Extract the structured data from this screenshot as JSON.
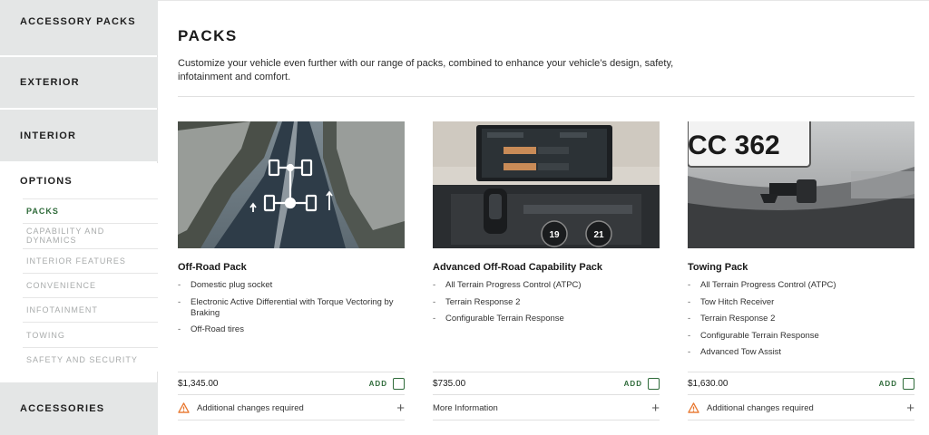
{
  "sidebar": {
    "sections": [
      {
        "label": "ACCESSORY PACKS"
      },
      {
        "label": "EXTERIOR"
      },
      {
        "label": "INTERIOR"
      },
      {
        "label": "OPTIONS"
      },
      {
        "label": "ACCESSORIES"
      }
    ],
    "options_items": [
      {
        "label": "PACKS",
        "active": true
      },
      {
        "label": "CAPABILITY AND DYNAMICS"
      },
      {
        "label": "INTERIOR FEATURES"
      },
      {
        "label": "CONVENIENCE"
      },
      {
        "label": "INFOTAINMENT"
      },
      {
        "label": "TOWING"
      },
      {
        "label": "SAFETY AND SECURITY"
      }
    ]
  },
  "main": {
    "title": "PACKS",
    "description": "Customize your vehicle even further with our range of packs, combined to enhance your vehicle’s design, safety, infotainment and comfort.",
    "cards": [
      {
        "title": "Off-Road Pack",
        "features": [
          "Domestic plug socket",
          "Electronic Active Differential with Torque Vectoring by Braking",
          "Off-Road tires"
        ],
        "price": "$1,345.00",
        "add_label": "ADD",
        "info_text": "Additional changes required",
        "info_icon": "warning-icon"
      },
      {
        "title": "Advanced Off-Road Capability Pack",
        "features": [
          "All Terrain Progress Control (ATPC)",
          "Terrain Response 2",
          "Configurable Terrain Response"
        ],
        "price": "$735.00",
        "add_label": "ADD",
        "info_text": "More Information",
        "info_icon": ""
      },
      {
        "title": "Towing Pack",
        "features": [
          "All Terrain Progress Control (ATPC)",
          "Tow Hitch Receiver",
          "Terrain Response 2",
          "Configurable Terrain Response",
          "Advanced Tow Assist"
        ],
        "price": "$1,630.00",
        "add_label": "ADD",
        "info_text": "Additional changes required",
        "info_icon": "warning-icon"
      }
    ],
    "image_text": {
      "plate": "CC 362",
      "temp_left": "19",
      "temp_right": "21"
    }
  },
  "colors": {
    "accent_green": "#2f6b3a",
    "warning_orange": "#e8772e",
    "sidebar_bg": "#e4e6e6"
  }
}
